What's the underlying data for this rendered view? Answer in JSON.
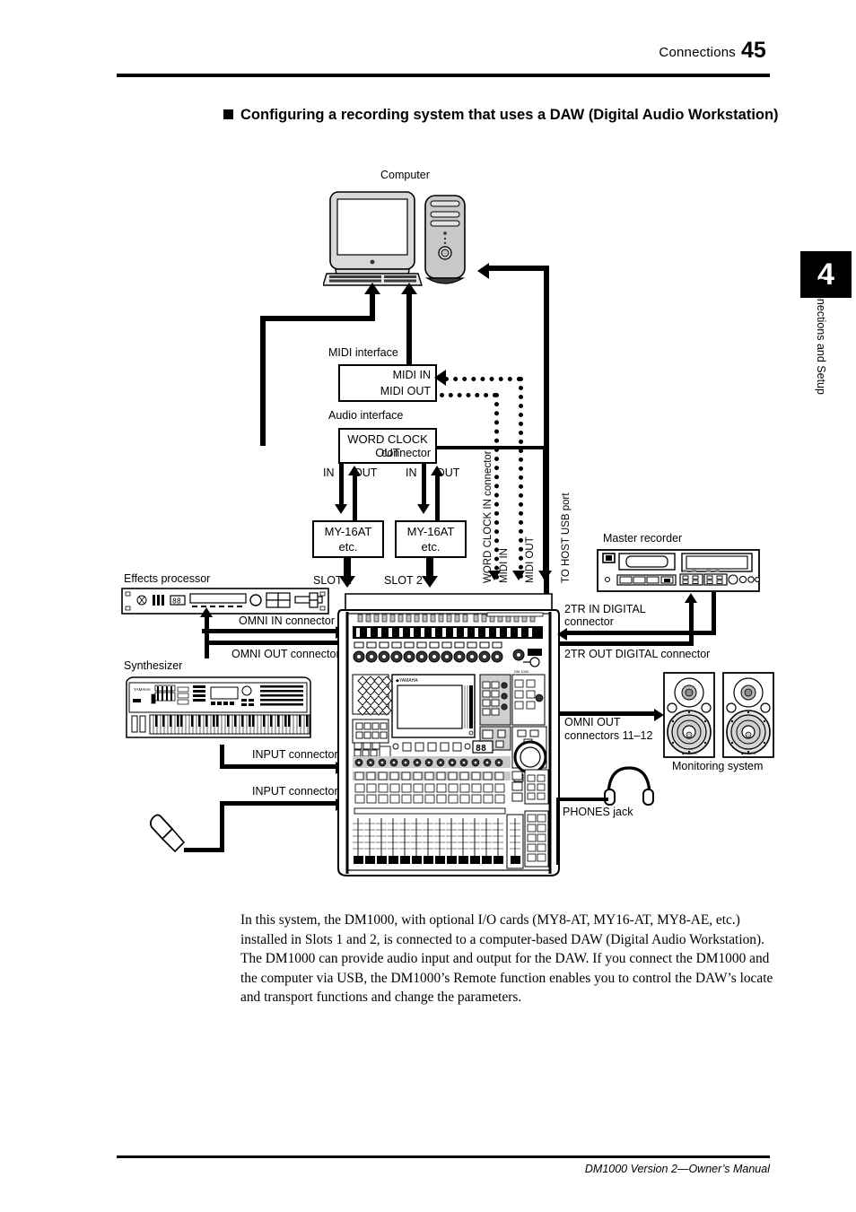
{
  "header": {
    "title": "Connections",
    "page_number": "45"
  },
  "chapter_tab": {
    "number": "4",
    "label": "Connections and Setup"
  },
  "section": {
    "heading": "Configuring a recording system that uses a DAW (Digital Audio Workstation)"
  },
  "diagram": {
    "computer_label": "Computer",
    "midi_interface_label": "MIDI interface",
    "midi_in": "MIDI IN",
    "midi_out": "MIDI OUT",
    "audio_interface_label": "Audio interface",
    "word_clock_out_line1": "WORD CLOCK OUT",
    "word_clock_out_line2": "connector",
    "in1": "IN",
    "out1": "OUT",
    "in2": "IN",
    "out2": "OUT",
    "card1_line1": "MY-16AT",
    "card1_line2": "etc.",
    "card2_line1": "MY-16AT",
    "card2_line2": "etc.",
    "slot1": "SLOT 1",
    "slot2": "SLOT 2",
    "word_clock_in_connector": "WORD CLOCK IN connector",
    "mixer_midi_in": "MIDI IN",
    "mixer_midi_out": "MIDI OUT",
    "to_host_usb_port": "TO HOST USB port",
    "effects_processor_label": "Effects processor",
    "omni_in_connector": "OMNI IN connector",
    "omni_out_connector": "OMNI OUT connector",
    "synthesizer_label": "Synthesizer",
    "input_connector_1": "INPUT connector",
    "input_connector_2": "INPUT connector",
    "master_recorder_label": "Master recorder",
    "tr2_in_digital_line1": "2TR IN DIGITAL",
    "tr2_in_digital_line2": "connector",
    "tr2_out_digital": "2TR OUT DIGITAL connector",
    "omni_out_11_12_line1": "OMNI OUT",
    "omni_out_11_12_line2": "connectors 11–12",
    "monitoring_system_label": "Monitoring system",
    "phones_jack_label": "PHONES jack",
    "mixer_brand": "YAMAHA"
  },
  "body": {
    "paragraph": "In this system, the DM1000, with optional I/O cards (MY8-AT, MY16-AT, MY8-AE, etc.) installed in Slots 1 and 2, is connected to a computer-based DAW (Digital Audio Workstation). The DM1000 can provide audio input and output for the DAW. If you connect the DM1000 and the computer via USB, the DM1000’s Remote function enables you to control the DAW’s locate and transport functions and change the parameters."
  },
  "footer": {
    "text": "DM1000 Version 2—Owner’s Manual"
  },
  "colors": {
    "ink": "#000000",
    "paper": "#ffffff",
    "device_fill": "#d9d9d9"
  }
}
